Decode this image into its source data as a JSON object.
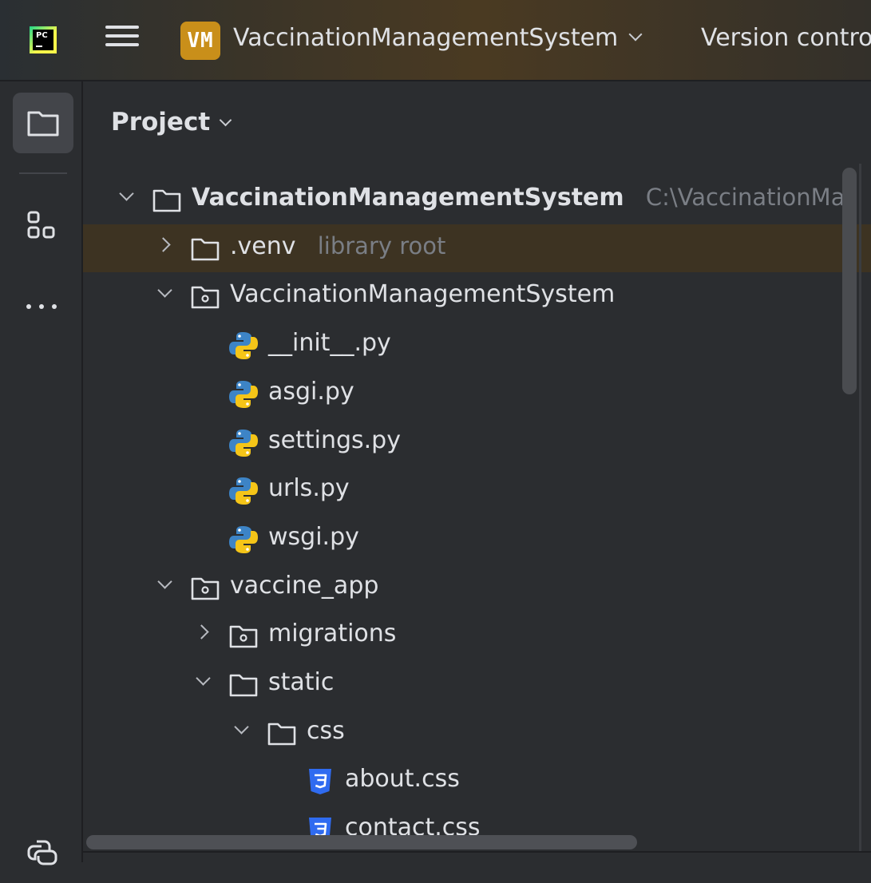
{
  "titlebar": {
    "badge": "VM",
    "project_name": "VaccinationManagementSystem",
    "vcs_label": "Version control"
  },
  "toolstrip": {
    "items": [
      {
        "icon": "folder-icon",
        "active": true
      },
      {
        "icon": "structure-icon",
        "active": false
      },
      {
        "icon": "more-icon",
        "active": false
      },
      {
        "icon": "python-console-icon",
        "active": false
      }
    ]
  },
  "panel": {
    "title": "Project"
  },
  "tree": [
    {
      "name": "VaccinationManagementSystem",
      "hint": "C:\\VaccinationMa",
      "depth": 0,
      "state": "expanded",
      "icon": "folder-icon",
      "bold": true
    },
    {
      "name": ".venv",
      "hint": "library root",
      "depth": 1,
      "state": "collapsed",
      "icon": "folder-icon",
      "highlight": true
    },
    {
      "name": "VaccinationManagementSystem",
      "depth": 1,
      "state": "expanded",
      "icon": "package-icon"
    },
    {
      "name": "__init__.py",
      "depth": 2,
      "state": "leaf",
      "icon": "python-file-icon"
    },
    {
      "name": "asgi.py",
      "depth": 2,
      "state": "leaf",
      "icon": "python-file-icon"
    },
    {
      "name": "settings.py",
      "depth": 2,
      "state": "leaf",
      "icon": "python-file-icon"
    },
    {
      "name": "urls.py",
      "depth": 2,
      "state": "leaf",
      "icon": "python-file-icon"
    },
    {
      "name": "wsgi.py",
      "depth": 2,
      "state": "leaf",
      "icon": "python-file-icon"
    },
    {
      "name": "vaccine_app",
      "depth": 1,
      "state": "expanded",
      "icon": "package-icon"
    },
    {
      "name": "migrations",
      "depth": 2,
      "state": "collapsed",
      "icon": "package-icon"
    },
    {
      "name": "static",
      "depth": 2,
      "state": "expanded",
      "icon": "folder-icon"
    },
    {
      "name": "css",
      "depth": 3,
      "state": "expanded",
      "icon": "folder-icon"
    },
    {
      "name": "about.css",
      "depth": 4,
      "state": "leaf",
      "icon": "css-file-icon"
    },
    {
      "name": "contact.css",
      "depth": 4,
      "state": "leaf",
      "icon": "css-file-icon"
    }
  ]
}
